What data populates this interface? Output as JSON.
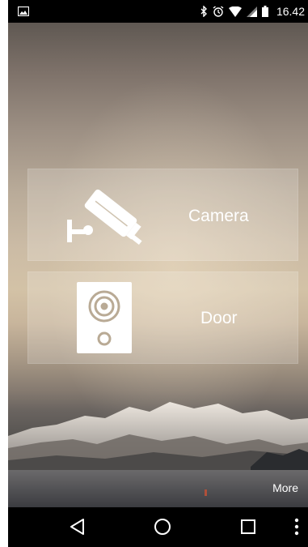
{
  "status_bar": {
    "time": "16.42",
    "icons": [
      "image-notification-icon",
      "bluetooth-icon",
      "alarm-icon",
      "wifi-icon",
      "cell-signal-icon",
      "battery-icon"
    ]
  },
  "tiles": [
    {
      "id": "camera",
      "label": "Camera",
      "icon": "security-camera-icon"
    },
    {
      "id": "door",
      "label": "Door",
      "icon": "door-intercom-icon"
    }
  ],
  "more_label": "More",
  "nav": {
    "icons": [
      "back-icon",
      "home-icon",
      "recent-apps-icon",
      "overflow-menu-icon"
    ]
  },
  "colors": {
    "tile_background": "rgba(255,255,255,0.18)",
    "text": "#ffffff",
    "bars": "#000000"
  }
}
